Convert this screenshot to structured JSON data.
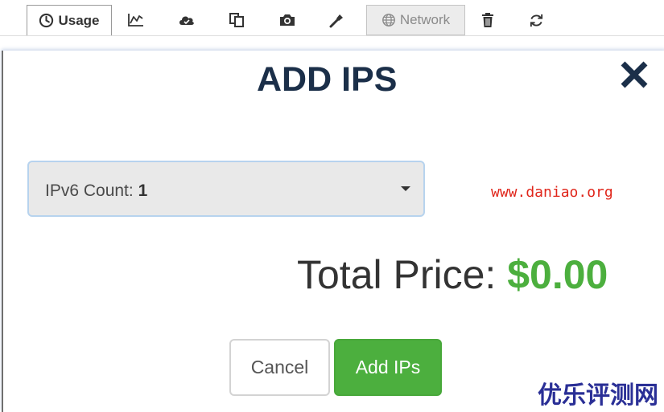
{
  "toolbar": {
    "tabs": [
      {
        "id": "usage",
        "label": "Usage",
        "icon": "clock-icon"
      },
      {
        "id": "graphs",
        "label": "",
        "icon": "line-chart-icon"
      },
      {
        "id": "backups",
        "label": "",
        "icon": "cloud-icon"
      },
      {
        "id": "clone",
        "label": "",
        "icon": "copy-icon"
      },
      {
        "id": "snapshots",
        "label": "",
        "icon": "camera-icon"
      },
      {
        "id": "tools",
        "label": "",
        "icon": "tools-icon"
      },
      {
        "id": "network",
        "label": "Network",
        "icon": "globe-icon"
      },
      {
        "id": "destroy",
        "label": "",
        "icon": "trash-icon"
      },
      {
        "id": "reinstall",
        "label": "",
        "icon": "refresh-icon"
      }
    ],
    "active_tab": "network"
  },
  "modal": {
    "title": "ADD IPS",
    "close_icon": "close-icon",
    "select": {
      "label": "IPv6 Count:",
      "value": "1"
    },
    "total_price_label": "Total Price:",
    "total_price_value": "$0.00",
    "cancel_label": "Cancel",
    "add_label": "Add IPs"
  },
  "watermarks": {
    "url": "www.daniao.org",
    "cn": "优乐评测网"
  },
  "colors": {
    "title": "#1b2f49",
    "price_green": "#4caf3e",
    "add_button": "#4caf3e",
    "select_bg": "#e9e9e9",
    "select_border": "#b7d3ee",
    "watermark_url": "#e0261b",
    "watermark_cn": "#2a2f96"
  }
}
